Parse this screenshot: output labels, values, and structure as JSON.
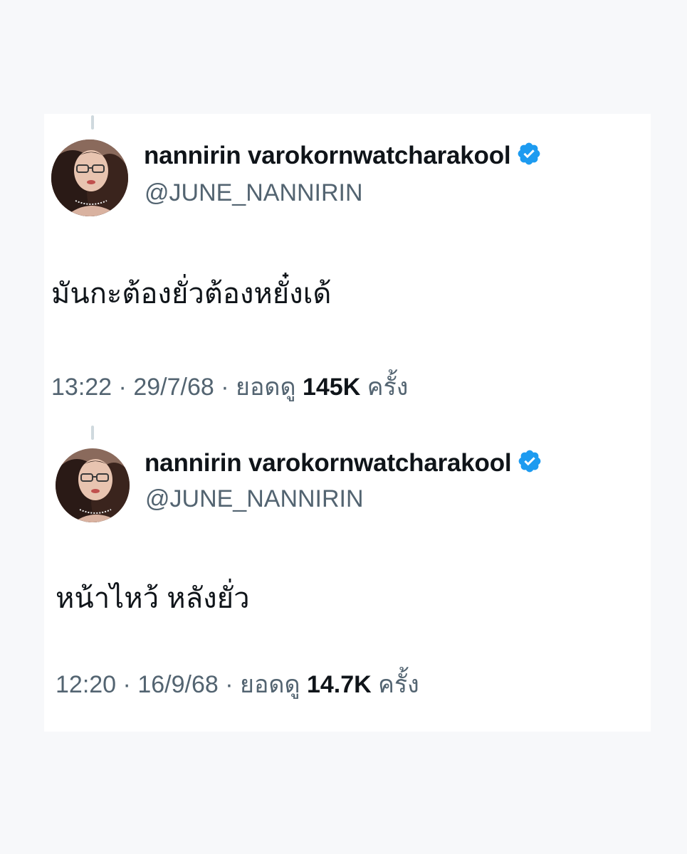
{
  "tweets": [
    {
      "display_name": "nannirin varokornwatcharakool",
      "handle": "@JUNE_NANNIRIN",
      "text": "มันกะต้องยั่วต้องหยั๋งเด้",
      "time": "13:22",
      "date": "29/7/68",
      "views_label": "ยอดดู",
      "views_count": "145K",
      "views_suffix": "ครั้ง",
      "verified": true
    },
    {
      "display_name": "nannirin varokornwatcharakool",
      "handle": "@JUNE_NANNIRIN",
      "text": "หน้าไหว้ หลังยั่ว",
      "time": "12:20",
      "date": "16/9/68",
      "views_label": "ยอดดู",
      "views_count": "14.7K",
      "views_suffix": "ครั้ง",
      "verified": true
    }
  ],
  "separator": "·",
  "colors": {
    "background": "#f7f8fa",
    "card": "#ffffff",
    "text_primary": "#0f1419",
    "text_secondary": "#536471",
    "verified_badge": "#1d9bf0"
  },
  "icons": {
    "verified": "verified-badge-icon",
    "avatar": "profile-avatar"
  }
}
